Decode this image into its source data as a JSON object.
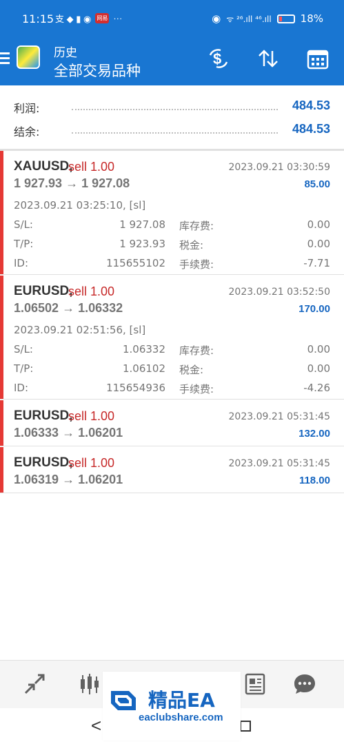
{
  "status_bar": {
    "time": "11:15",
    "left_glyphs": "支 ◆ ▮ ◉",
    "badge": "网易",
    "more": "···",
    "signal": "ᯤ ²⁶.ıll ⁴⁶.ıll",
    "battery_pct": "18%"
  },
  "header": {
    "subtitle": "历史",
    "title": "全部交易品种"
  },
  "summary": {
    "profit_label": "利润:",
    "profit_value": "484.53",
    "balance_label": "结余:",
    "balance_value": "484.53"
  },
  "labels": {
    "sl": "S/L:",
    "tp": "T/P:",
    "id": "ID:",
    "swap": "库存费:",
    "taxes": "税金:",
    "commission": "手续费:"
  },
  "trades": [
    {
      "symbol": "XAUUSD,",
      "side": "sell 1.00",
      "close_time": "2023.09.21 03:30:59",
      "prices": "1 927.93 → 1 927.08",
      "profit": "85.00",
      "open_time": "2023.09.21 03:25:10, [sl]",
      "sl": "1 927.08",
      "tp": "1 923.93",
      "id": "115655102",
      "swap": "0.00",
      "taxes": "0.00",
      "commission": "-7.71"
    },
    {
      "symbol": "EURUSD,",
      "side": "sell 1.00",
      "close_time": "2023.09.21 03:52:50",
      "prices": "1.06502 → 1.06332",
      "profit": "170.00",
      "open_time": "2023.09.21 02:51:56, [sl]",
      "sl": "1.06332",
      "tp": "1.06102",
      "id": "115654936",
      "swap": "0.00",
      "taxes": "0.00",
      "commission": "-4.26"
    },
    {
      "symbol": "EURUSD,",
      "side": "sell 1.00",
      "close_time": "2023.09.21 05:31:45",
      "prices": "1.06333 → 1.06201",
      "profit": "132.00"
    },
    {
      "symbol": "EURUSD,",
      "side": "sell 1.00",
      "close_time": "2023.09.21 05:31:45",
      "prices": "1.06319 → 1.06201",
      "profit": "118.00"
    }
  ],
  "watermark": {
    "title": "精品EA",
    "url": "eaclubshare.com"
  },
  "colors": {
    "header_bg": "#1976d2",
    "profit_blue": "#1565c0",
    "sell_red": "#c62828",
    "bar_red": "#e53935"
  },
  "icons": {
    "header": [
      "dollar-refresh-icon",
      "sort-arrows-icon",
      "calendar-icon"
    ],
    "bottom_nav": [
      "trade-arrows-icon",
      "candlestick-icon",
      "news-icon",
      "chat-icon"
    ]
  }
}
